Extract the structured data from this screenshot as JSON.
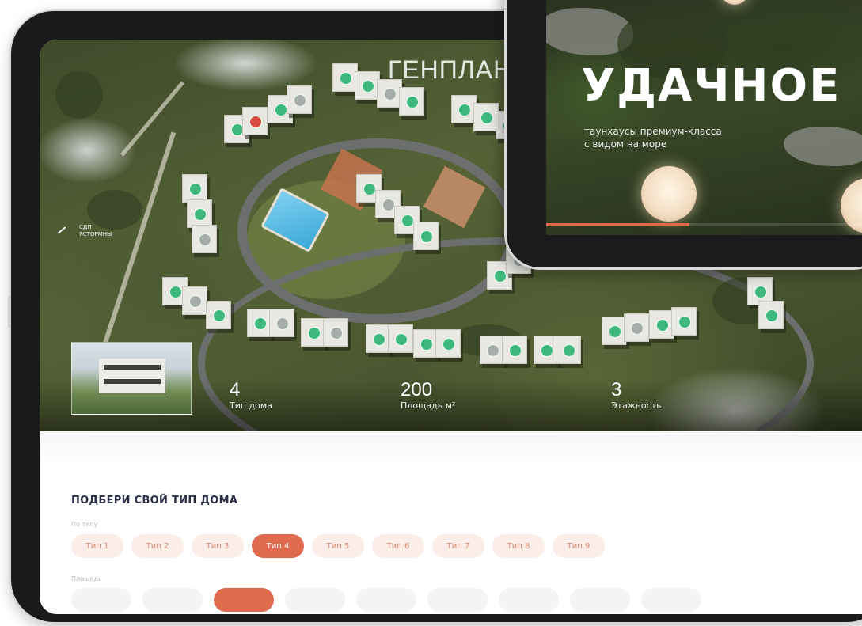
{
  "masterplan": {
    "title": "ГЕНПЛАН",
    "road_label": "СДП\nЯСТОРМНЫ"
  },
  "stats": [
    {
      "value": "4",
      "label": "Тип дома"
    },
    {
      "value": "200",
      "label": "Площадь м²"
    },
    {
      "value": "3",
      "label": "Этажность"
    }
  ],
  "selector": {
    "title": "ПОДБЕРИ СВОЙ ТИП ДОМА",
    "filter_label": "По типу",
    "filter_label_2": "Площадь",
    "types": [
      "Тип 1",
      "Тип 2",
      "Тип 3",
      "Тип 4",
      "Тип 5",
      "Тип 6",
      "Тип 7",
      "Тип 8",
      "Тип 9"
    ],
    "active_type": "Тип 4"
  },
  "hero": {
    "title": "УДАЧНОЕ",
    "subtitle_line1": "таунхаусы премиум-класса",
    "subtitle_line2": "с видом на море",
    "slide_progress": 0.42
  },
  "colors": {
    "accent": "#df6a4e",
    "chip_bg": "#fbeee9",
    "chip_text": "#d98b73",
    "marker_available": "#3fb87e",
    "marker_sold": "#a8acaa",
    "marker_selected": "#d94b3e",
    "title_text": "#2a2f4a"
  }
}
